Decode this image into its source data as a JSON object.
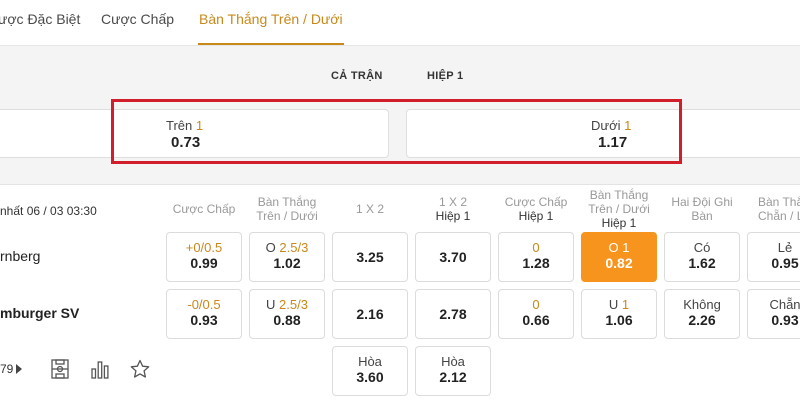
{
  "tabs": [
    {
      "label": "ược Đặc Biệt"
    },
    {
      "label": "Cược Chấp"
    },
    {
      "label": "Bàn Thắng Trên / Dưới"
    }
  ],
  "period_tabs": [
    {
      "label": "CẢ TRẬN"
    },
    {
      "label": "HIỆP 1"
    }
  ],
  "over_under": {
    "over": {
      "label": "Trên",
      "line": "1",
      "odd": "0.73"
    },
    "under": {
      "label": "Dưới",
      "line": "1",
      "odd": "1.17"
    }
  },
  "match": {
    "time": "nhất 06 / 03 03:30",
    "home_team": "rnberg",
    "away_team": "mburger SV",
    "more_count": "79"
  },
  "columns": [
    {
      "line1": "Cược Chấp",
      "line2": ""
    },
    {
      "line1": "Bàn Thắng",
      "line2": "Trên / Dưới"
    },
    {
      "line1": "1 X 2",
      "line2": ""
    },
    {
      "line1": "1 X 2",
      "line2": "Hiệp 1"
    },
    {
      "line1": "Cược Chấp",
      "line2": "Hiệp 1"
    },
    {
      "line1": "Bàn Thắng",
      "line2": "Trên / Dưới",
      "line3": "Hiệp 1"
    },
    {
      "line1": "Hai Đội Ghi",
      "line2": "Bàn"
    },
    {
      "line1": "Bàn Thắng",
      "line2": "Chẵn / Lẻ"
    }
  ],
  "odds": {
    "r1": [
      {
        "prefix": "",
        "line": "+0/0.5",
        "value": "0.99"
      },
      {
        "prefix": "O ",
        "line": "2.5/3",
        "value": "1.02"
      },
      {
        "prefix": "",
        "line": "",
        "value": "3.25"
      },
      {
        "prefix": "",
        "line": "",
        "value": "3.70"
      },
      {
        "prefix": "",
        "line": "0",
        "value": "1.28"
      },
      {
        "prefix": "O ",
        "line": "1",
        "value": "0.82"
      },
      {
        "prefix": "Có",
        "line": "",
        "value": "1.62"
      },
      {
        "prefix": "Lẻ",
        "line": "",
        "value": "0.95"
      }
    ],
    "r2": [
      {
        "prefix": "",
        "line": "-0/0.5",
        "value": "0.93"
      },
      {
        "prefix": "U ",
        "line": "2.5/3",
        "value": "0.88"
      },
      {
        "prefix": "",
        "line": "",
        "value": "2.16"
      },
      {
        "prefix": "",
        "line": "",
        "value": "2.78"
      },
      {
        "prefix": "",
        "line": "0",
        "value": "0.66"
      },
      {
        "prefix": "U ",
        "line": "1",
        "value": "1.06"
      },
      {
        "prefix": "Không",
        "line": "",
        "value": "2.26"
      },
      {
        "prefix": "Chẵn",
        "line": "",
        "value": "0.93"
      }
    ],
    "r3": [
      {
        "prefix": "Hòa",
        "line": "",
        "value": "3.60"
      },
      {
        "prefix": "Hòa",
        "line": "",
        "value": "2.12"
      }
    ]
  },
  "icons": {
    "play": "play-triangle-icon",
    "field": "field-icon",
    "stats": "stats-bars-icon",
    "favorite": "star-icon"
  },
  "colors": {
    "accent": "#c8891a",
    "selected": "#f7941d",
    "highlight_border": "#d21e2a"
  }
}
